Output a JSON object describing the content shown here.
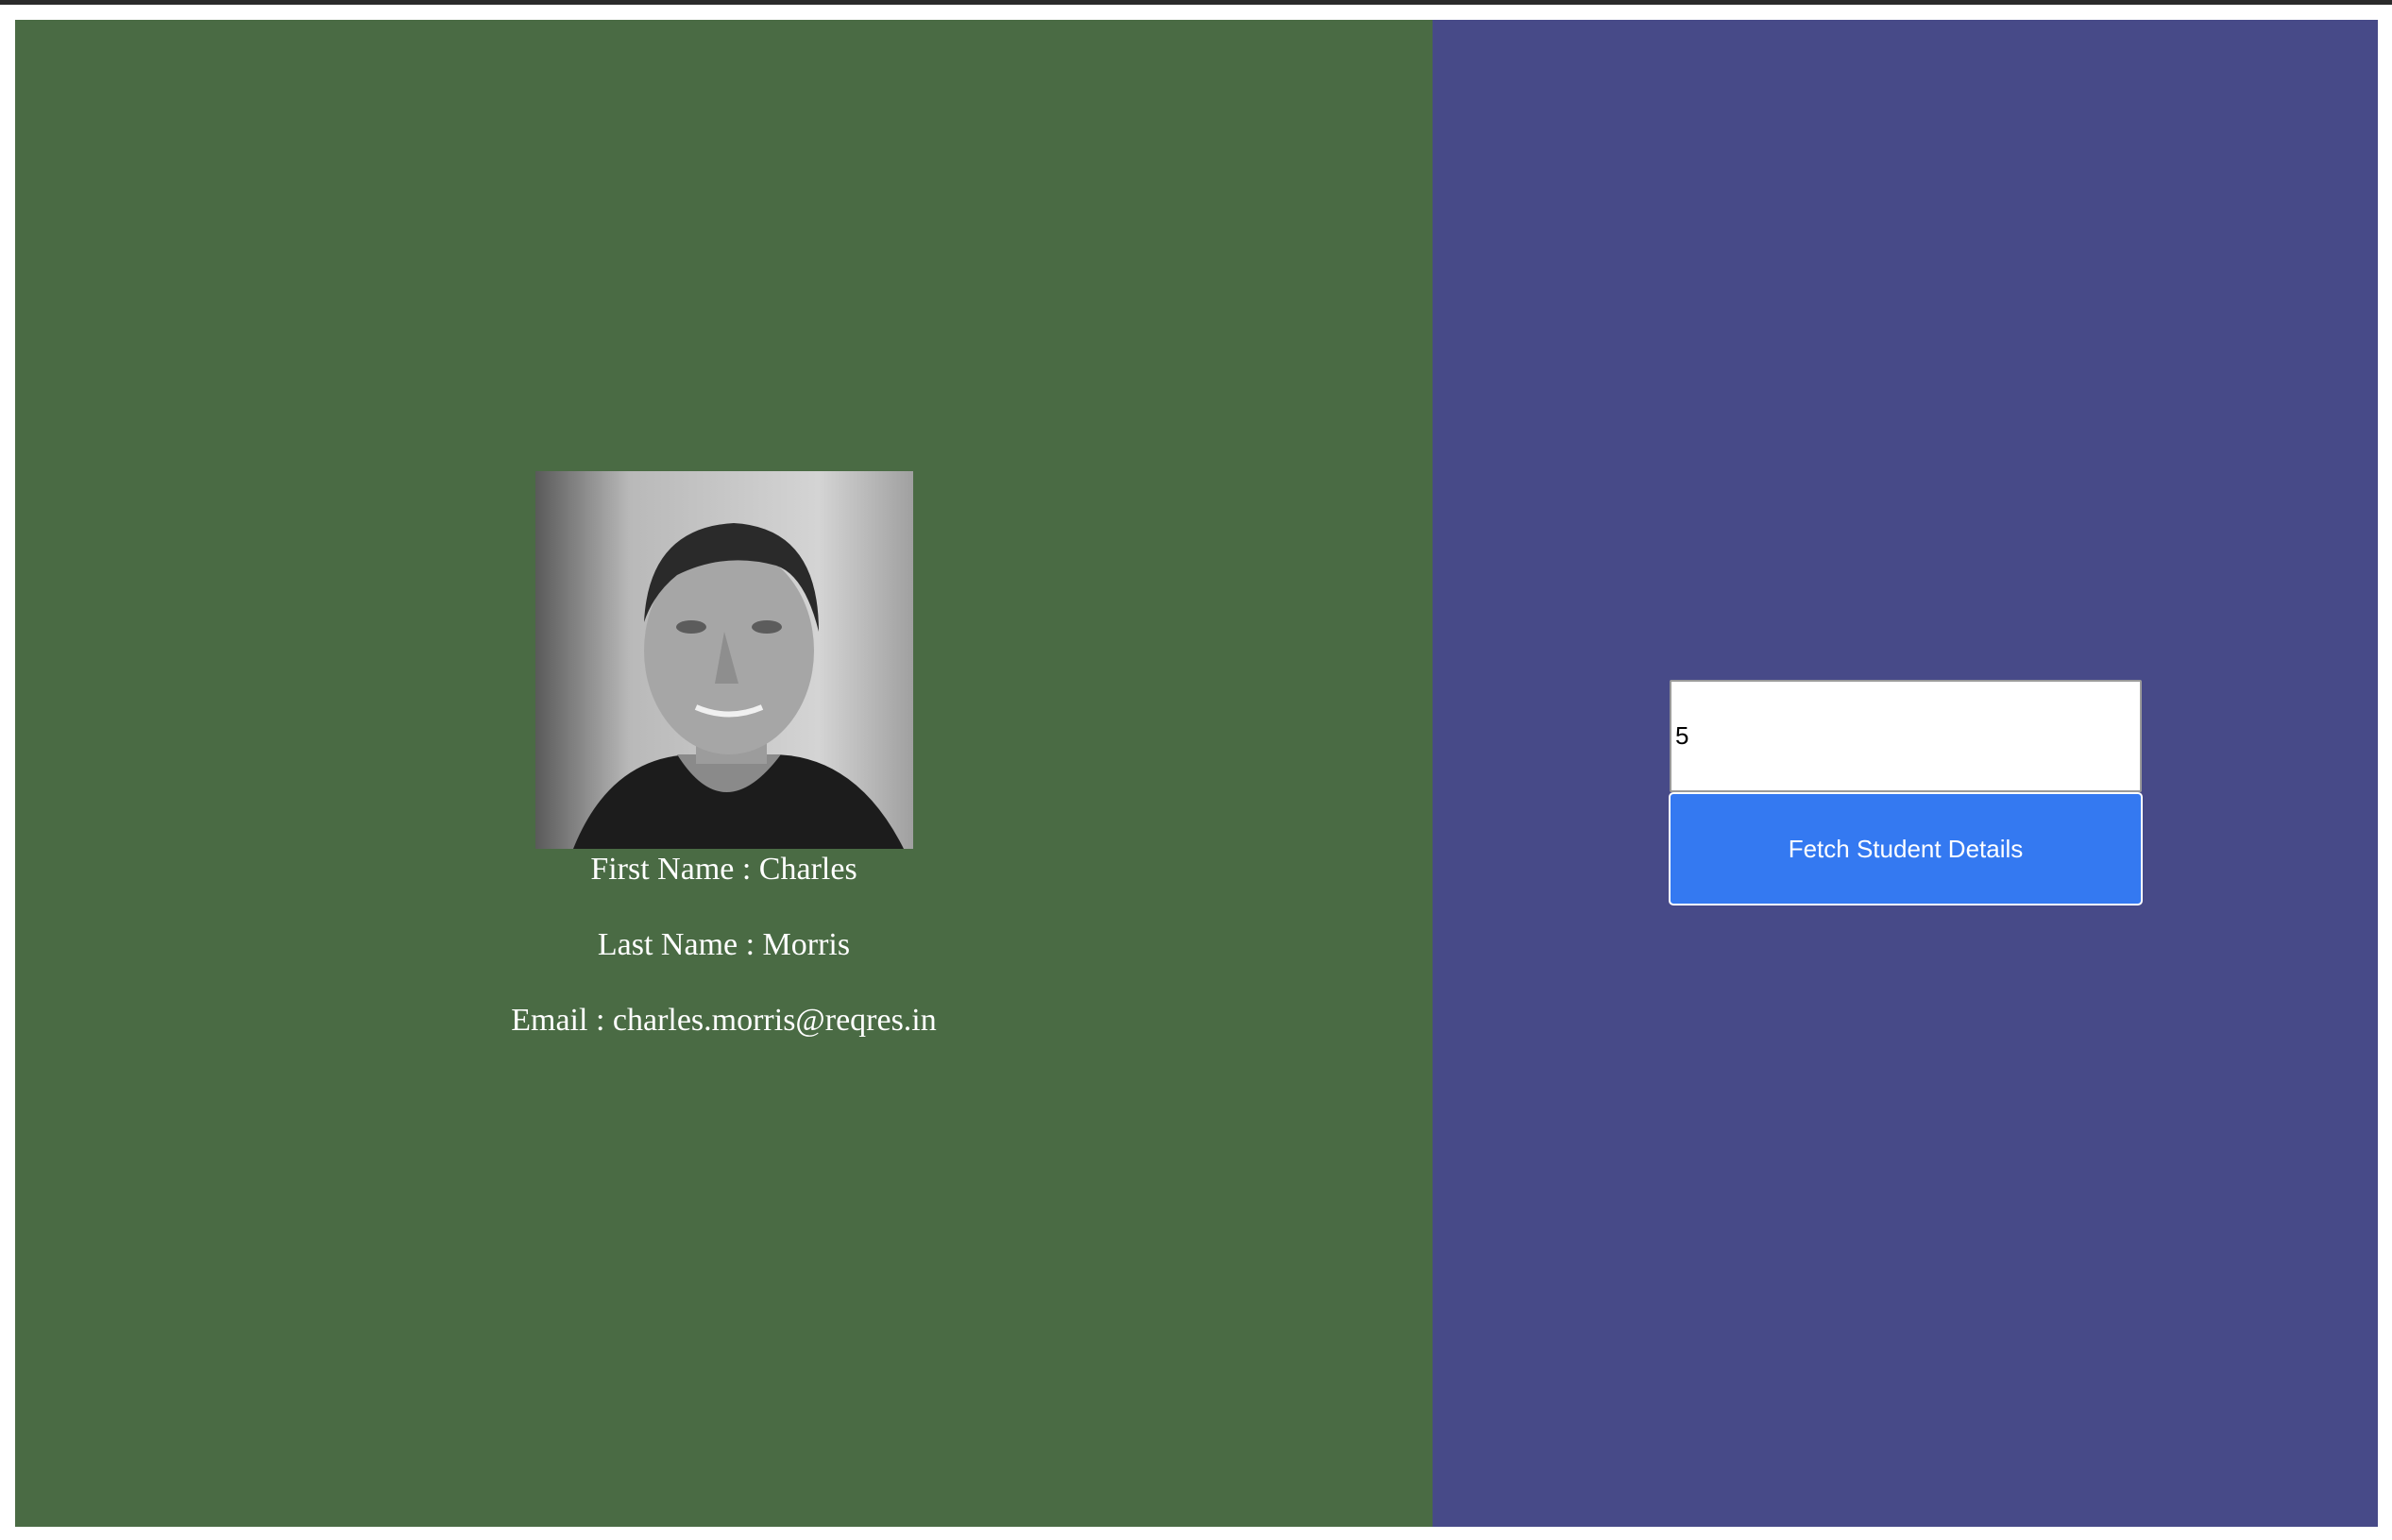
{
  "student": {
    "photo_icon": "portrait-photo",
    "first_name_text": "First Name : Charles",
    "last_name_text": "Last Name : Morris",
    "email_text": "Email : charles.morris@reqres.in"
  },
  "form": {
    "id_value": "5",
    "fetch_label": "Fetch Student Details"
  },
  "colors": {
    "left_panel": "#4a6b44",
    "right_panel": "#474a88",
    "button": "#3479f1"
  }
}
